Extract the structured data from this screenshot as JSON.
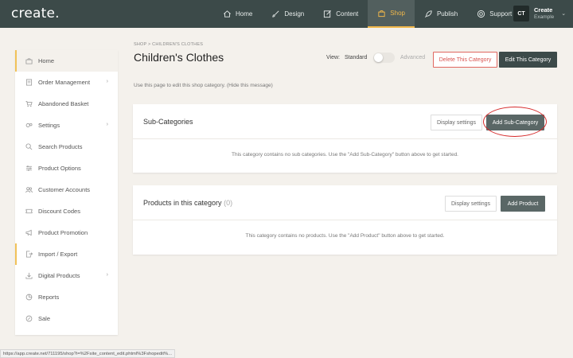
{
  "app": {
    "logo": "create."
  },
  "nav": {
    "items": [
      {
        "label": "Home",
        "icon": "home-icon"
      },
      {
        "label": "Design",
        "icon": "brush-icon"
      },
      {
        "label": "Content",
        "icon": "edit-icon"
      },
      {
        "label": "Shop",
        "icon": "basket-icon"
      },
      {
        "label": "Publish",
        "icon": "rocket-icon"
      },
      {
        "label": "Support",
        "icon": "lifebuoy-icon"
      }
    ],
    "active": "Shop"
  },
  "account": {
    "initials": "CT",
    "name": "Create",
    "subtitle": "Example"
  },
  "sidebar": {
    "items": [
      {
        "label": "Home",
        "icon": "basket-icon"
      },
      {
        "label": "Order Management",
        "icon": "orders-icon"
      },
      {
        "label": "Abandoned Basket",
        "icon": "cart-icon"
      },
      {
        "label": "Settings",
        "icon": "gears-icon"
      },
      {
        "label": "Search Products",
        "icon": "search-icon"
      },
      {
        "label": "Product Options",
        "icon": "sliders-icon"
      },
      {
        "label": "Customer Accounts",
        "icon": "users-icon"
      },
      {
        "label": "Discount Codes",
        "icon": "ticket-icon"
      },
      {
        "label": "Product Promotion",
        "icon": "megaphone-icon"
      },
      {
        "label": "Import / Export",
        "icon": "file-export-icon"
      },
      {
        "label": "Digital Products",
        "icon": "download-icon"
      },
      {
        "label": "Reports",
        "icon": "chart-icon"
      },
      {
        "label": "Sale",
        "icon": "tag-icon"
      }
    ]
  },
  "page": {
    "breadcrumb": "SHOP  >  CHILDREN'S CLOTHES",
    "title": "Children's Clothes",
    "view_label": "View:",
    "view_standard": "Standard",
    "view_advanced": "Advanced",
    "delete_label": "Delete This Category",
    "edit_label": "Edit This Category",
    "helper": "Use this page to edit this shop category. (Hide this message)"
  },
  "subcategories": {
    "title": "Sub-Categories",
    "display_label": "Display settings",
    "add_label": "Add Sub-Category",
    "empty": "This category contains no sub categories. Use the \"Add Sub-Category\" button above to get started."
  },
  "products": {
    "title": "Products in this category",
    "count": "(0)",
    "display_label": "Display settings",
    "add_label": "Add Product",
    "empty": "This category contains no products. Use the \"Add Product\" button above to get started."
  },
  "status_url": "https://app.create.net/711195/shop?i=%2Fsite_content_edit.phtml%3Fshopedit%...",
  "colors": {
    "topbar": "#3c4a49",
    "accent": "#f1b84a",
    "danger": "#d9534f",
    "dark_button": "#3c4a49"
  }
}
